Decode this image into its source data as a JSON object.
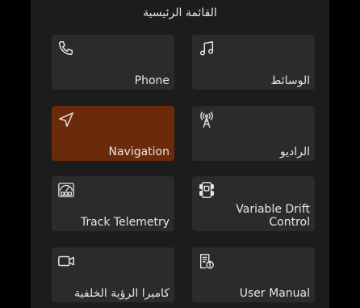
{
  "header": {
    "title": "القائمة الرئيسية"
  },
  "tiles": [
    {
      "label": "Phone",
      "icon": "phone-icon"
    },
    {
      "label": "الوسائط",
      "icon": "music-note-icon"
    },
    {
      "label": "Navigation",
      "icon": "navigation-arrow-icon",
      "active": true
    },
    {
      "label": "الراديو",
      "icon": "radio-antenna-icon"
    },
    {
      "label": "Track Telemetry",
      "icon": "telemetry-gauge-icon"
    },
    {
      "label_line1": "Variable Drift",
      "label_line2": "Control",
      "icon": "drift-control-icon"
    },
    {
      "label": "كاميرا الرؤية الخلفية",
      "icon": "camera-icon"
    },
    {
      "label": "User Manual",
      "icon": "manual-info-icon"
    }
  ],
  "colors": {
    "active_tile": "#6b2a0a",
    "tile": "#2b2b2b",
    "background": "#1c1c1c"
  }
}
